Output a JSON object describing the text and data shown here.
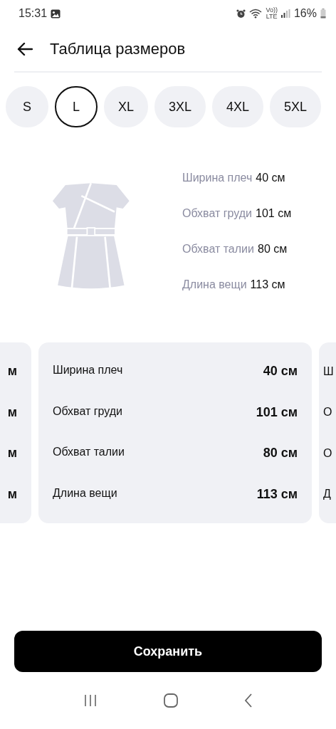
{
  "status_bar": {
    "time": "15:31",
    "volte_top": "Vo))",
    "volte_bottom": "LTE",
    "battery": "16%"
  },
  "header": {
    "title": "Таблица размеров"
  },
  "sizes": [
    {
      "label": "S",
      "selected": false
    },
    {
      "label": "L",
      "selected": true
    },
    {
      "label": "XL",
      "selected": false
    },
    {
      "label": "3XL",
      "selected": false
    },
    {
      "label": "4XL",
      "selected": false
    },
    {
      "label": "5XL",
      "selected": false
    }
  ],
  "measurements": [
    {
      "label": "Ширина плеч",
      "value": "40 см"
    },
    {
      "label": "Обхват груди",
      "value": "101 см"
    },
    {
      "label": "Обхват талии",
      "value": "80 см"
    },
    {
      "label": "Длина вещи",
      "value": "113 см"
    }
  ],
  "previous_card": {
    "values": [
      "м",
      "м",
      "м",
      "м"
    ]
  },
  "card": {
    "rows": [
      {
        "label": "Ширина плеч",
        "value": "40 см"
      },
      {
        "label": "Обхват груди",
        "value": "101 см"
      },
      {
        "label": "Обхват талии",
        "value": "80 см"
      },
      {
        "label": "Длина вещи",
        "value": "113 см"
      }
    ]
  },
  "next_card": {
    "labels": [
      "Ш",
      "О",
      "О",
      "Д"
    ]
  },
  "save_button": {
    "label": "Сохранить"
  }
}
